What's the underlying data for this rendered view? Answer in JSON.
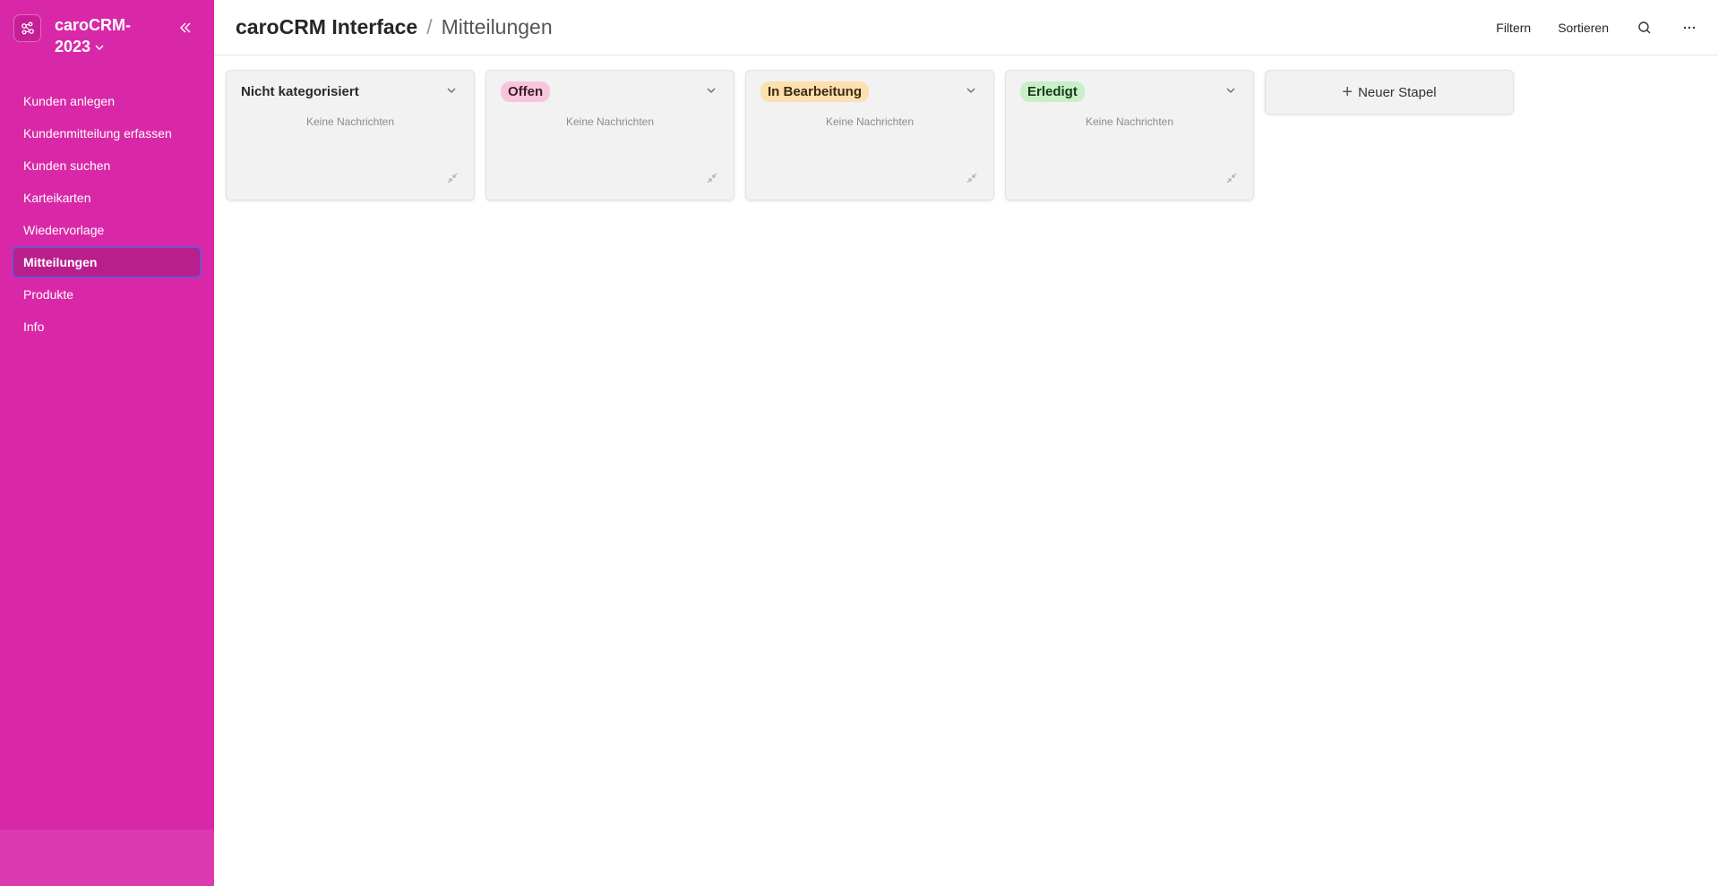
{
  "workspace": {
    "name": "caroCRM-2023",
    "icon": "workspace-network-icon"
  },
  "sidebar": {
    "items": [
      {
        "label": "Kunden anlegen",
        "active": false
      },
      {
        "label": "Kundenmitteilung erfassen",
        "active": false
      },
      {
        "label": "Kunden suchen",
        "active": false
      },
      {
        "label": "Karteikarten",
        "active": false
      },
      {
        "label": "Wiedervorlage",
        "active": false
      },
      {
        "label": "Mitteilungen",
        "active": true
      },
      {
        "label": "Produkte",
        "active": false
      },
      {
        "label": "Info",
        "active": false
      }
    ]
  },
  "header": {
    "app": "caroCRM Interface",
    "separator": "/",
    "page": "Mitteilungen",
    "actions": {
      "filter": "Filtern",
      "sort": "Sortieren"
    }
  },
  "board": {
    "columns": [
      {
        "title": "Nicht kategorisiert",
        "style": "plain",
        "empty_text": "Keine Nachrichten"
      },
      {
        "title": "Offen",
        "style": "pill",
        "color": "#f8c6dc",
        "empty_text": "Keine Nachrichten"
      },
      {
        "title": "In Bearbeitung",
        "style": "pill",
        "color": "#fde0b0",
        "empty_text": "Keine Nachrichten"
      },
      {
        "title": "Erledigt",
        "style": "pill",
        "color": "#c9efc9",
        "empty_text": "Keine Nachrichten"
      }
    ],
    "new_stack_label": "Neuer Stapel"
  },
  "colors": {
    "sidebar_bg": "#d928a7",
    "sidebar_active": "#b81f8c",
    "focus_ring": "#7a4fd6"
  }
}
